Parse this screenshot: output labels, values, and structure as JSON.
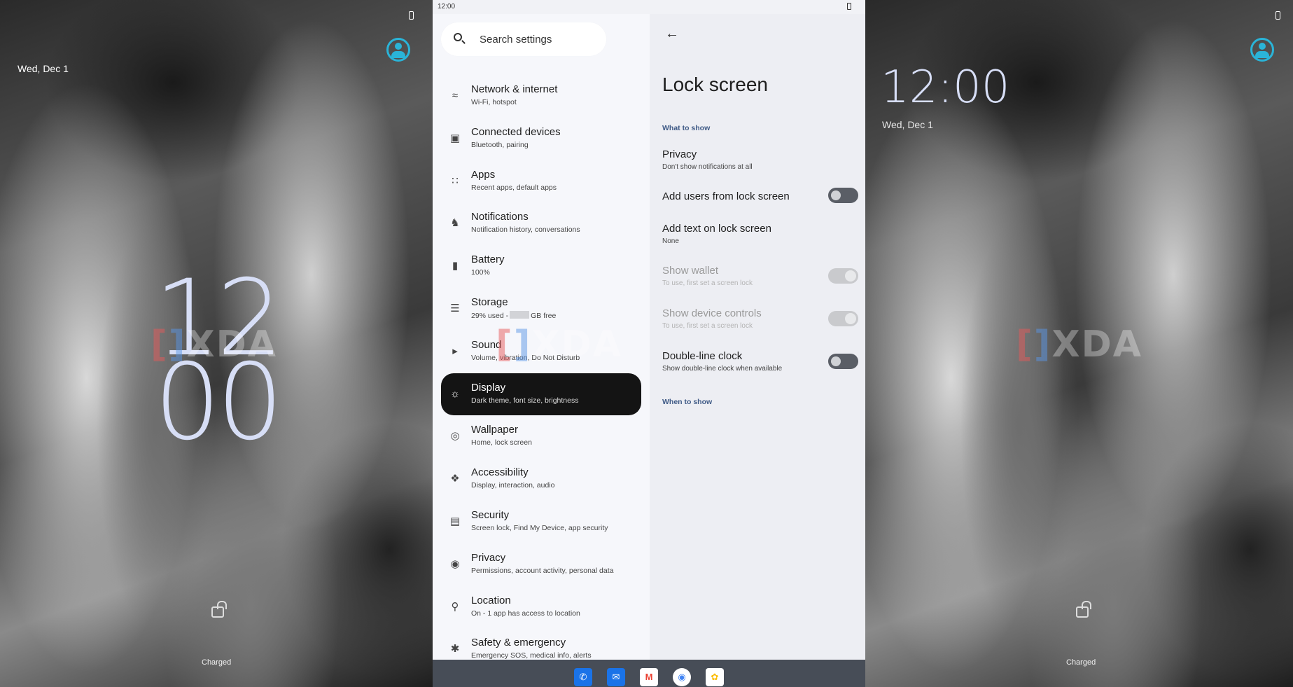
{
  "lock_left": {
    "date": "Wed, Dec 1",
    "clock_hours": "12",
    "clock_minutes": "00",
    "charged": "Charged"
  },
  "lock_right": {
    "clock": "12:00",
    "date": "Wed, Dec 1",
    "charged": "Charged"
  },
  "watermark": "XDA",
  "status": {
    "time": "12:00"
  },
  "search": {
    "placeholder": "Search settings"
  },
  "menu": [
    {
      "title": "Network & internet",
      "subtitle": "Wi-Fi, hotspot",
      "icon": "wifi-icon"
    },
    {
      "title": "Connected devices",
      "subtitle": "Bluetooth, pairing",
      "icon": "devices-icon"
    },
    {
      "title": "Apps",
      "subtitle": "Recent apps, default apps",
      "icon": "apps-icon"
    },
    {
      "title": "Notifications",
      "subtitle": "Notification history, conversations",
      "icon": "bell-icon"
    },
    {
      "title": "Battery",
      "subtitle": "100%",
      "icon": "battery-icon"
    },
    {
      "title": "Storage",
      "subtitle_pre": "29% used -",
      "subtitle_post": "GB free",
      "icon": "storage-icon"
    },
    {
      "title": "Sound",
      "subtitle": "Volume, vibration, Do Not Disturb",
      "icon": "speaker-icon"
    },
    {
      "title": "Display",
      "subtitle": "Dark theme, font size, brightness",
      "icon": "brightness-icon"
    },
    {
      "title": "Wallpaper",
      "subtitle": "Home, lock screen",
      "icon": "palette-icon"
    },
    {
      "title": "Accessibility",
      "subtitle": "Display, interaction, audio",
      "icon": "accessibility-icon"
    },
    {
      "title": "Security",
      "subtitle": "Screen lock, Find My Device, app security",
      "icon": "lock-icon"
    },
    {
      "title": "Privacy",
      "subtitle": "Permissions, account activity, personal data",
      "icon": "eye-icon"
    },
    {
      "title": "Location",
      "subtitle": "On - 1 app has access to location",
      "icon": "location-pin-icon"
    },
    {
      "title": "Safety & emergency",
      "subtitle": "Emergency SOS, medical info, alerts",
      "icon": "asterisk-icon"
    }
  ],
  "detail": {
    "title": "Lock screen",
    "section_what": "What to show",
    "section_when": "When to show",
    "rows": [
      {
        "title": "Privacy",
        "subtitle": "Don't show notifications at all"
      },
      {
        "title": "Add users from lock screen",
        "toggle": false
      },
      {
        "title": "Add text on lock screen",
        "subtitle": "None"
      },
      {
        "title": "Show wallet",
        "subtitle": "To use, first set a screen lock",
        "toggle": true,
        "disabled": true
      },
      {
        "title": "Show device controls",
        "subtitle": "To use, first set a screen lock",
        "toggle": true,
        "disabled": true
      },
      {
        "title": "Double-line clock",
        "subtitle": "Show double-line clock when available",
        "toggle": false
      }
    ]
  },
  "taskbar": {
    "apps": [
      "phone-icon",
      "messages-icon",
      "gmail-icon",
      "chrome-icon",
      "photos-icon"
    ],
    "colors": {
      "phone": "#1a73e8",
      "messages": "#1a73e8",
      "gmail": "#ea4335",
      "chrome": "#4285f4",
      "photos": "#fbbc04"
    }
  }
}
